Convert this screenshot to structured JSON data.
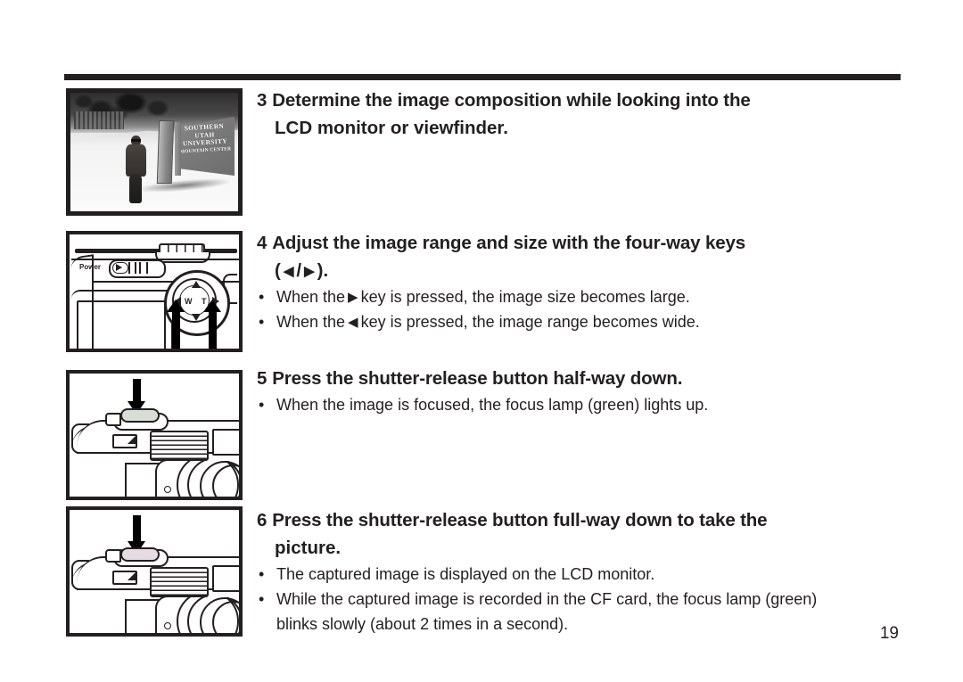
{
  "document": {
    "page_number": "19"
  },
  "steps": [
    {
      "number": "3",
      "heading_line1": "Determine the image composition while looking into the",
      "heading_line2": "LCD monitor or viewfinder.",
      "figure": {
        "type": "photograph",
        "name": "sample-photo-snow-scene",
        "sign_line1": "SOUTHERN",
        "sign_line2": "UTAH",
        "sign_line3": "UNIVERSITY",
        "sign_line4": "MOUNTAIN CENTER"
      },
      "bullets": []
    },
    {
      "number": "4",
      "heading_line1": "Adjust the image range and size with the four-way keys",
      "heading_line2_prefix": "(",
      "heading_left_arrow": "◀",
      "heading_separator": "/",
      "heading_right_arrow": "▶",
      "heading_line2_suffix": ").",
      "figure": {
        "type": "line-drawing",
        "name": "camera-back-four-way-keys",
        "power_label": "Power",
        "pad_w_label": "W",
        "pad_t_label": "T"
      },
      "bullets": [
        {
          "prefix": "When the",
          "arrow": "▶",
          "suffix": "key is pressed, the image size becomes large."
        },
        {
          "prefix": "When the",
          "arrow": "◀",
          "suffix": "key is pressed, the image range becomes wide."
        }
      ]
    },
    {
      "number": "5",
      "heading_line1": "Press the shutter-release button half-way down.",
      "figure": {
        "type": "line-drawing",
        "name": "camera-top-shutter-half-press"
      },
      "bullets": [
        {
          "text": "When the image is focused, the focus lamp (green) lights up."
        }
      ]
    },
    {
      "number": "6",
      "heading_line1": "Press the shutter-release button full-way down to take the",
      "heading_line2": "picture.",
      "figure": {
        "type": "line-drawing",
        "name": "camera-top-shutter-full-press"
      },
      "bullets": [
        {
          "text": "The captured image is displayed on the LCD monitor."
        },
        {
          "text": "While the captured image is recorded in the CF card, the focus lamp (green)",
          "continuation": "blinks slowly (about 2 times in a second)."
        }
      ]
    }
  ],
  "glyphs": {
    "bullet_dot": "•",
    "power_switch_play": "▷"
  },
  "colors": {
    "ink": "#231f20",
    "page_background": "#ffffff"
  }
}
